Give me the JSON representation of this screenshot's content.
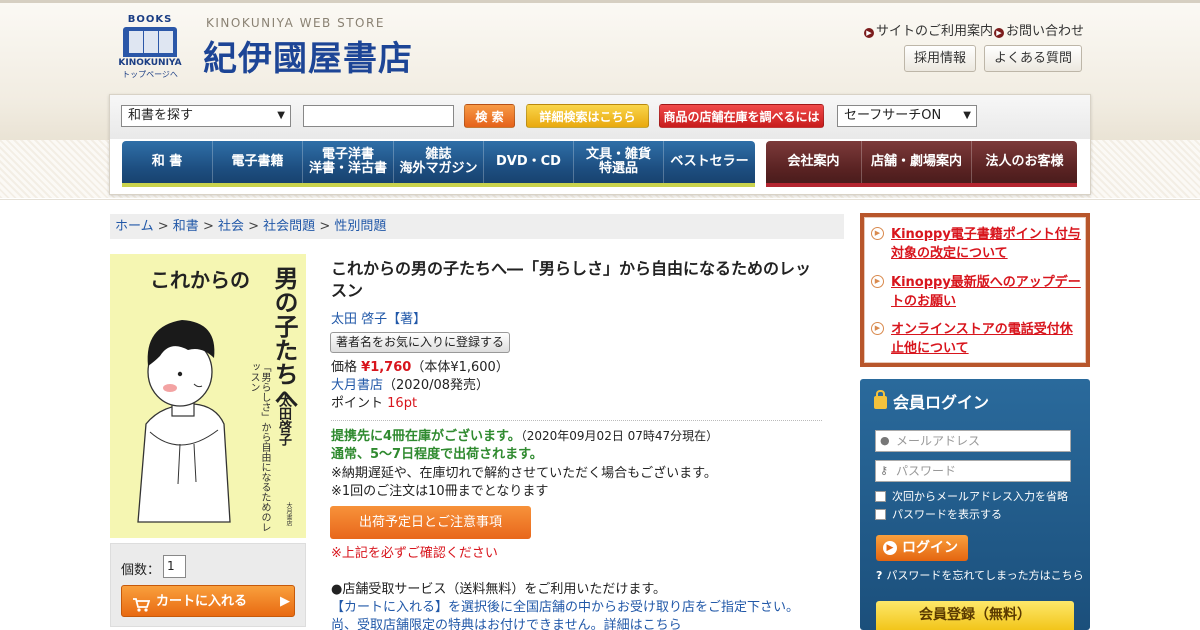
{
  "header": {
    "logo_top": "BOOKS",
    "logo_brand": "KINOKUNIYA",
    "logo_home": "トップページへ",
    "store_en": "KINOKUNIYA WEB STORE",
    "store_jp": "紀伊國屋書店",
    "link_usage": "サイトのご利用案内",
    "link_contact": "お問い合わせ",
    "btn_recruit": "採用情報",
    "btn_faq": "よくある質問"
  },
  "search": {
    "category": "和書を探す",
    "query": "",
    "search_btn": "検 索",
    "advanced_btn": "詳細検索はこちら",
    "stock_btn": "商品の店舗在庫を調べるには",
    "safe_search": "セーフサーチON"
  },
  "nav": {
    "main": [
      {
        "label": "和 書"
      },
      {
        "label": "電子書籍"
      },
      {
        "label": "電子洋書\n洋書・洋古書"
      },
      {
        "label": "雑誌\n海外マガジン"
      },
      {
        "label": "DVD・CD"
      },
      {
        "label": "文具・雑貨\n特選品"
      },
      {
        "label": "ベストセラー"
      }
    ],
    "corp": [
      {
        "label": "会社案内"
      },
      {
        "label": "店舗・劇場案内"
      },
      {
        "label": "法人のお客様"
      }
    ]
  },
  "breadcrumb": [
    "ホーム",
    "和書",
    "社会",
    "社会問題",
    "性別問題"
  ],
  "book": {
    "cover_title_a": "これからの",
    "cover_title_b": "男の子たちへ",
    "cover_subtitle": "「男らしさ」から自由になるためのレッスン",
    "cover_author": "太田啓子",
    "cover_publisher": "大月書店",
    "title": "これからの男の子たちへ―「男らしさ」から自由になるためのレッスン",
    "author": "太田 啓子【著】",
    "fav_btn": "著者名をお気に入りに登録する",
    "price_label": "価格",
    "price": "¥1,760",
    "price_base": "（本体¥1,600）",
    "publisher": "大月書店",
    "release": "（2020/08発売）",
    "point_label": "ポイント",
    "points": "16pt",
    "stock_msg": "提携先に4冊在庫がございます。",
    "stock_time": "（2020年09月02日 07時47分現在）",
    "ship_msg": "通常、5～7日程度で出荷されます。",
    "note1": "※納期遅延や、在庫切れで解約させていただく場合もございます。",
    "note2": "※1回のご注文は10冊までとなります",
    "ship_btn": "出荷予定日とご注意事項",
    "confirm_note": "※上記を必ずご確認ください",
    "pickup1": "●店舗受取サービス（送料無料）をご利用いただけます。",
    "pickup2": "【カートに入れる】を選択後に全国店舗の中からお受け取り店をご指定下さい。",
    "pickup3": "尚、受取店舗限定の特典はお付けできません。詳細はこちら"
  },
  "cart": {
    "qty_label": "個数：",
    "qty": "1",
    "cart_btn": "カートに入れる"
  },
  "news": [
    "Kinoppy電子書籍ポイント付与対象の改定について",
    "Kinoppy最新版へのアップデートのお願い",
    "オンラインストアの電話受付休止他について"
  ],
  "login": {
    "title": "会員ログイン",
    "email_placeholder": "メールアドレス",
    "password_placeholder": "パスワード",
    "remember": "次回からメールアドレス入力を省略",
    "show_pw": "パスワードを表示する",
    "login_btn": "ログイン",
    "forgot": "パスワードを忘れてしまった方はこちら",
    "register_btn": "会員登録（無料）"
  }
}
